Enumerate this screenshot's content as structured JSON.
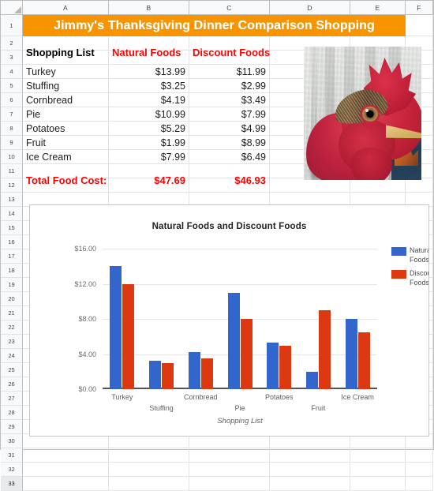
{
  "app": {
    "type": "spreadsheet",
    "column_headers": [
      "A",
      "B",
      "C",
      "D",
      "E",
      "F"
    ],
    "row_numbers": [
      "1",
      "2",
      "3",
      "4",
      "5",
      "6",
      "7",
      "8",
      "9",
      "10",
      "11",
      "12",
      "13",
      "14",
      "15",
      "16",
      "17",
      "18",
      "19",
      "20",
      "21",
      "22",
      "23",
      "24",
      "25",
      "26",
      "27",
      "28",
      "29",
      "30",
      "31",
      "32",
      "33"
    ],
    "selected_row": "33"
  },
  "title_banner": {
    "text": "Jimmy's Thanksgiving Dinner Comparison Shopping",
    "background": "#f79400",
    "color": "#ffffff"
  },
  "table": {
    "headers": [
      "Shopping List",
      "Natural Foods",
      "Discount Foods"
    ],
    "header_colors": [
      "#000000",
      "#ff0000",
      "#ff0000"
    ],
    "rows": [
      {
        "item": "Turkey",
        "natural": "$13.99",
        "discount": "$11.99"
      },
      {
        "item": "Stuffing",
        "natural": "$3.25",
        "discount": "$2.99"
      },
      {
        "item": "Cornbread",
        "natural": "$4.19",
        "discount": "$3.49"
      },
      {
        "item": "Pie",
        "natural": "$10.99",
        "discount": "$7.99"
      },
      {
        "item": "Potatoes",
        "natural": "$5.29",
        "discount": "$4.99"
      },
      {
        "item": "Fruit",
        "natural": "$1.99",
        "discount": "$8.99"
      },
      {
        "item": "Ice Cream",
        "natural": "$7.99",
        "discount": "$6.49"
      }
    ],
    "total": {
      "label": "Total Food Cost:",
      "natural": "$47.69",
      "discount": "$46.93",
      "color": "#ff0000"
    }
  },
  "photo": {
    "alt": "turkey-head-photo",
    "description": "Close-up photograph of a turkey head with red wattle against a weathered grey wall"
  },
  "chart_data": {
    "type": "bar",
    "title": "Natural Foods and Discount Foods",
    "xlabel": "Shopping List",
    "ylabel": "",
    "categories": [
      "Turkey",
      "Stuffing",
      "Cornbread",
      "Pie",
      "Potatoes",
      "Fruit",
      "Ice Cream"
    ],
    "series": [
      {
        "name": "Natural Foods",
        "color": "#3366cc",
        "values": [
          13.99,
          3.25,
          4.19,
          10.99,
          5.29,
          1.99,
          7.99
        ]
      },
      {
        "name": "Discount Foods",
        "color": "#dc3912",
        "values": [
          11.99,
          2.99,
          3.49,
          7.99,
          4.99,
          8.99,
          6.49
        ]
      }
    ],
    "ylim": [
      0,
      16
    ],
    "yticks": [
      0,
      4,
      8,
      12,
      16
    ],
    "ytick_labels": [
      "$0.00",
      "$4.00",
      "$8.00",
      "$12.00",
      "$16.00"
    ],
    "grid": true,
    "legend_position": "right"
  }
}
